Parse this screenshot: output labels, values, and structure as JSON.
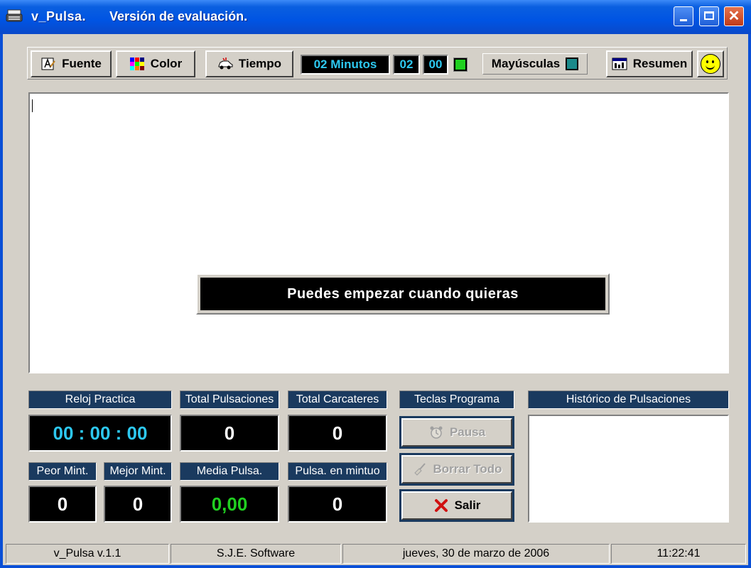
{
  "window": {
    "title": "v_Pulsa.",
    "subtitle": "Versión de evaluación.",
    "controls": {
      "close_glyph": "✕"
    }
  },
  "toolbar": {
    "fuente_label": "Fuente",
    "color_label": "Color",
    "tiempo_label": "Tiempo",
    "minutes_display": "02 Minutos",
    "minutes_value": "02",
    "seconds_value": "00",
    "mayusculas_label": "Mayúsculas",
    "resumen_label": "Resumen",
    "smiley": "☺"
  },
  "editor": {
    "banner_text": "Puedes empezar cuando quieras"
  },
  "stats": {
    "reloj_label": "Reloj Practica",
    "reloj_value": "00 : 00 : 00",
    "total_pulsaciones_label": "Total Pulsaciones",
    "total_pulsaciones_value": "0",
    "total_caracteres_label": "Total Carcateres",
    "total_caracteres_value": "0",
    "peor_label": "Peor Mint.",
    "peor_value": "0",
    "mejor_label": "Mejor Mint.",
    "mejor_value": "0",
    "media_label": "Media Pulsa.",
    "media_value": "0,00",
    "pulsa_minuto_label": "Pulsa. en mintuo",
    "pulsa_minuto_value": "0"
  },
  "teclas": {
    "header": "Teclas Programa",
    "pausa_label": "Pausa",
    "borrar_label": "Borrar Todo",
    "salir_label": "Salir"
  },
  "historico": {
    "header": "Histórico de Pulsaciones"
  },
  "statusbar": {
    "version": "v_Pulsa  v.1.1",
    "company": "S.J.E. Software",
    "date": "jueves, 30 de marzo de 2006",
    "time": "11:22:41"
  },
  "colors": {
    "title_blue": "#0054e3",
    "lcd_cyan": "#2dc8f0",
    "media_green": "#20d020",
    "label_navy": "#1a3a5f",
    "salir_red": "#d01010"
  }
}
